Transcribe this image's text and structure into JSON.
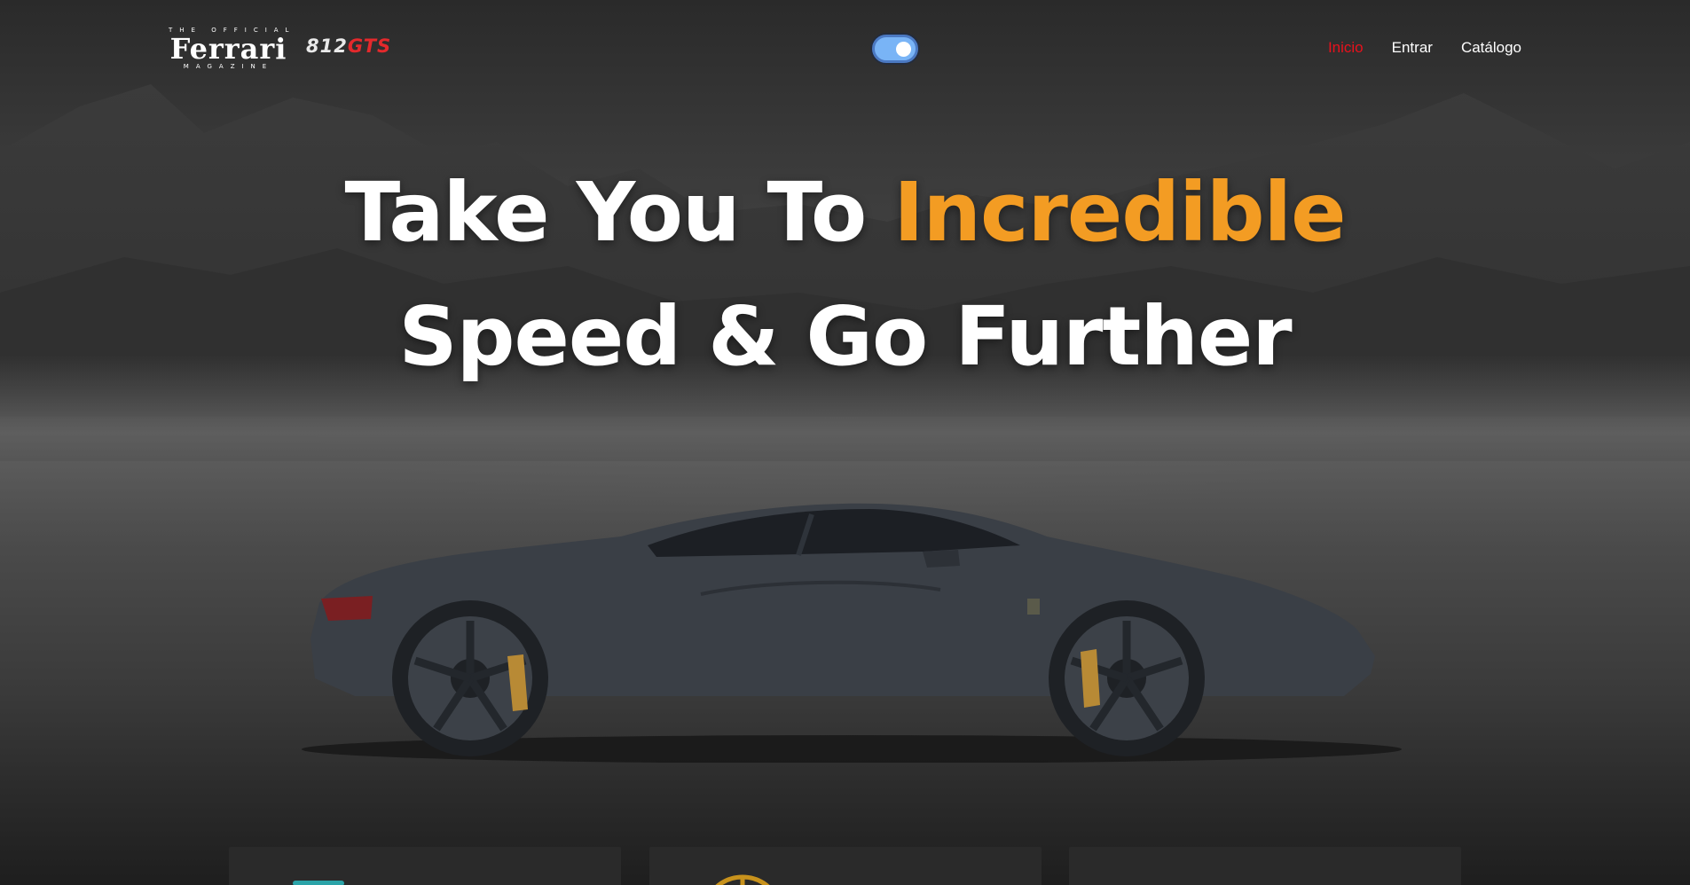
{
  "header": {
    "logo": {
      "top_text": "THE OFFICIAL",
      "main_text": "Ferrari",
      "bottom_text": "MAGAZINE"
    },
    "model": {
      "number": "812",
      "suffix": "GTS"
    },
    "theme_toggle": {
      "state": "on"
    },
    "nav": [
      {
        "label": "Inicio",
        "active": true
      },
      {
        "label": "Entrar",
        "active": false
      },
      {
        "label": "Catálogo",
        "active": false
      }
    ]
  },
  "hero": {
    "headline_part1": "Take You To ",
    "headline_accent": "Incredible",
    "headline_line2": "Speed & Go Further"
  },
  "colors": {
    "accent": "#f39c23",
    "nav_active": "#e8111c",
    "model_suffix": "#e3292c",
    "toggle": "#79b4f6"
  },
  "cards": [
    {
      "icon": "teal-stack-icon"
    },
    {
      "icon": "gold-circle-icon"
    },
    {
      "icon": "none"
    }
  ]
}
